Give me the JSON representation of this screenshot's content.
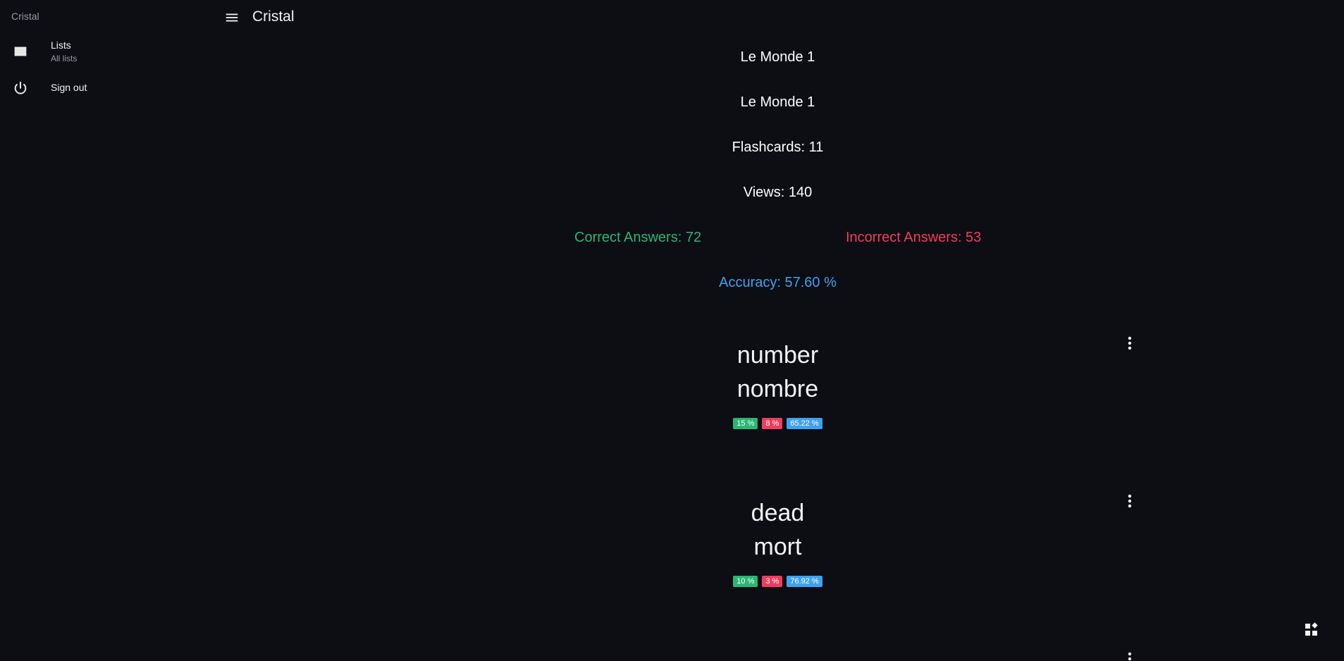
{
  "drawer": {
    "title": "Cristal",
    "items": [
      {
        "label": "Lists",
        "sublabel": "All lists",
        "icon": "dashboard-icon"
      },
      {
        "label": "Sign out",
        "icon": "power-icon"
      }
    ]
  },
  "topbar": {
    "title": "Cristal",
    "menu_icon": "menu-icon"
  },
  "list": {
    "name": "Le Monde 1",
    "description": "Le Monde 1",
    "flashcards": "Flashcards: 11",
    "views": "Views: 140",
    "correct": "Correct Answers: 72",
    "incorrect": "Incorrect Answers: 53",
    "accuracy": "Accuracy: 57.60 %"
  },
  "cards": [
    {
      "front": "number",
      "back": "nombre",
      "correct": "15 %",
      "incorrect": "8 %",
      "accuracy": "65.22 %"
    },
    {
      "front": "dead",
      "back": "mort",
      "correct": "10 %",
      "incorrect": "3 %",
      "accuracy": "76.92 %"
    }
  ],
  "colors": {
    "background": "#0d0d14",
    "correct": "#2bb673",
    "incorrect": "#ef3e5c",
    "accuracy": "#3ea2f0"
  }
}
